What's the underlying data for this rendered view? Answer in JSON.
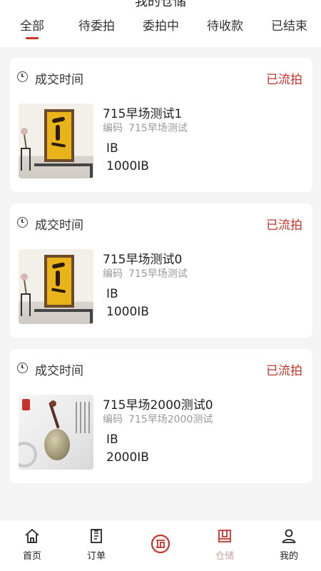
{
  "header": {
    "title": "我的仓储",
    "tabs": [
      {
        "label": "全部",
        "active": true
      },
      {
        "label": "待委拍",
        "active": false
      },
      {
        "label": "委拍中",
        "active": false
      },
      {
        "label": "待收款",
        "active": false
      },
      {
        "label": "已结束",
        "active": false
      }
    ]
  },
  "cards": [
    {
      "deal_label": "成交时间",
      "status": "已流拍",
      "name": "715早场测试1",
      "code_label": "编码",
      "code_value": "715早场测试",
      "unit": "IB",
      "price": "1000IB",
      "thumb": "calligraphy-scroll"
    },
    {
      "deal_label": "成交时间",
      "status": "已流拍",
      "name": "715早场测试0",
      "code_label": "编码",
      "code_value": "715早场测试",
      "unit": "IB",
      "price": "1000IB",
      "thumb": "calligraphy-scroll"
    },
    {
      "deal_label": "成交时间",
      "status": "已流拍",
      "name": "715早场2000测试0",
      "code_label": "编码",
      "code_value": "715早场2000测试",
      "unit": "IB",
      "price": "2000IB",
      "thumb": "jade-pendant"
    }
  ],
  "bottom_nav": [
    {
      "label": "首页",
      "icon": "home-icon",
      "active": false
    },
    {
      "label": "订单",
      "icon": "order-icon",
      "active": false
    },
    {
      "label": "",
      "icon": "auction-logo-icon",
      "active": false
    },
    {
      "label": "仓储",
      "icon": "storage-icon",
      "active": true
    },
    {
      "label": "我的",
      "icon": "profile-icon",
      "active": false
    }
  ],
  "colors": {
    "accent": "#c8322a",
    "inactive_tab_text": "#333333",
    "nav_active_text": "#c9a6a3"
  }
}
